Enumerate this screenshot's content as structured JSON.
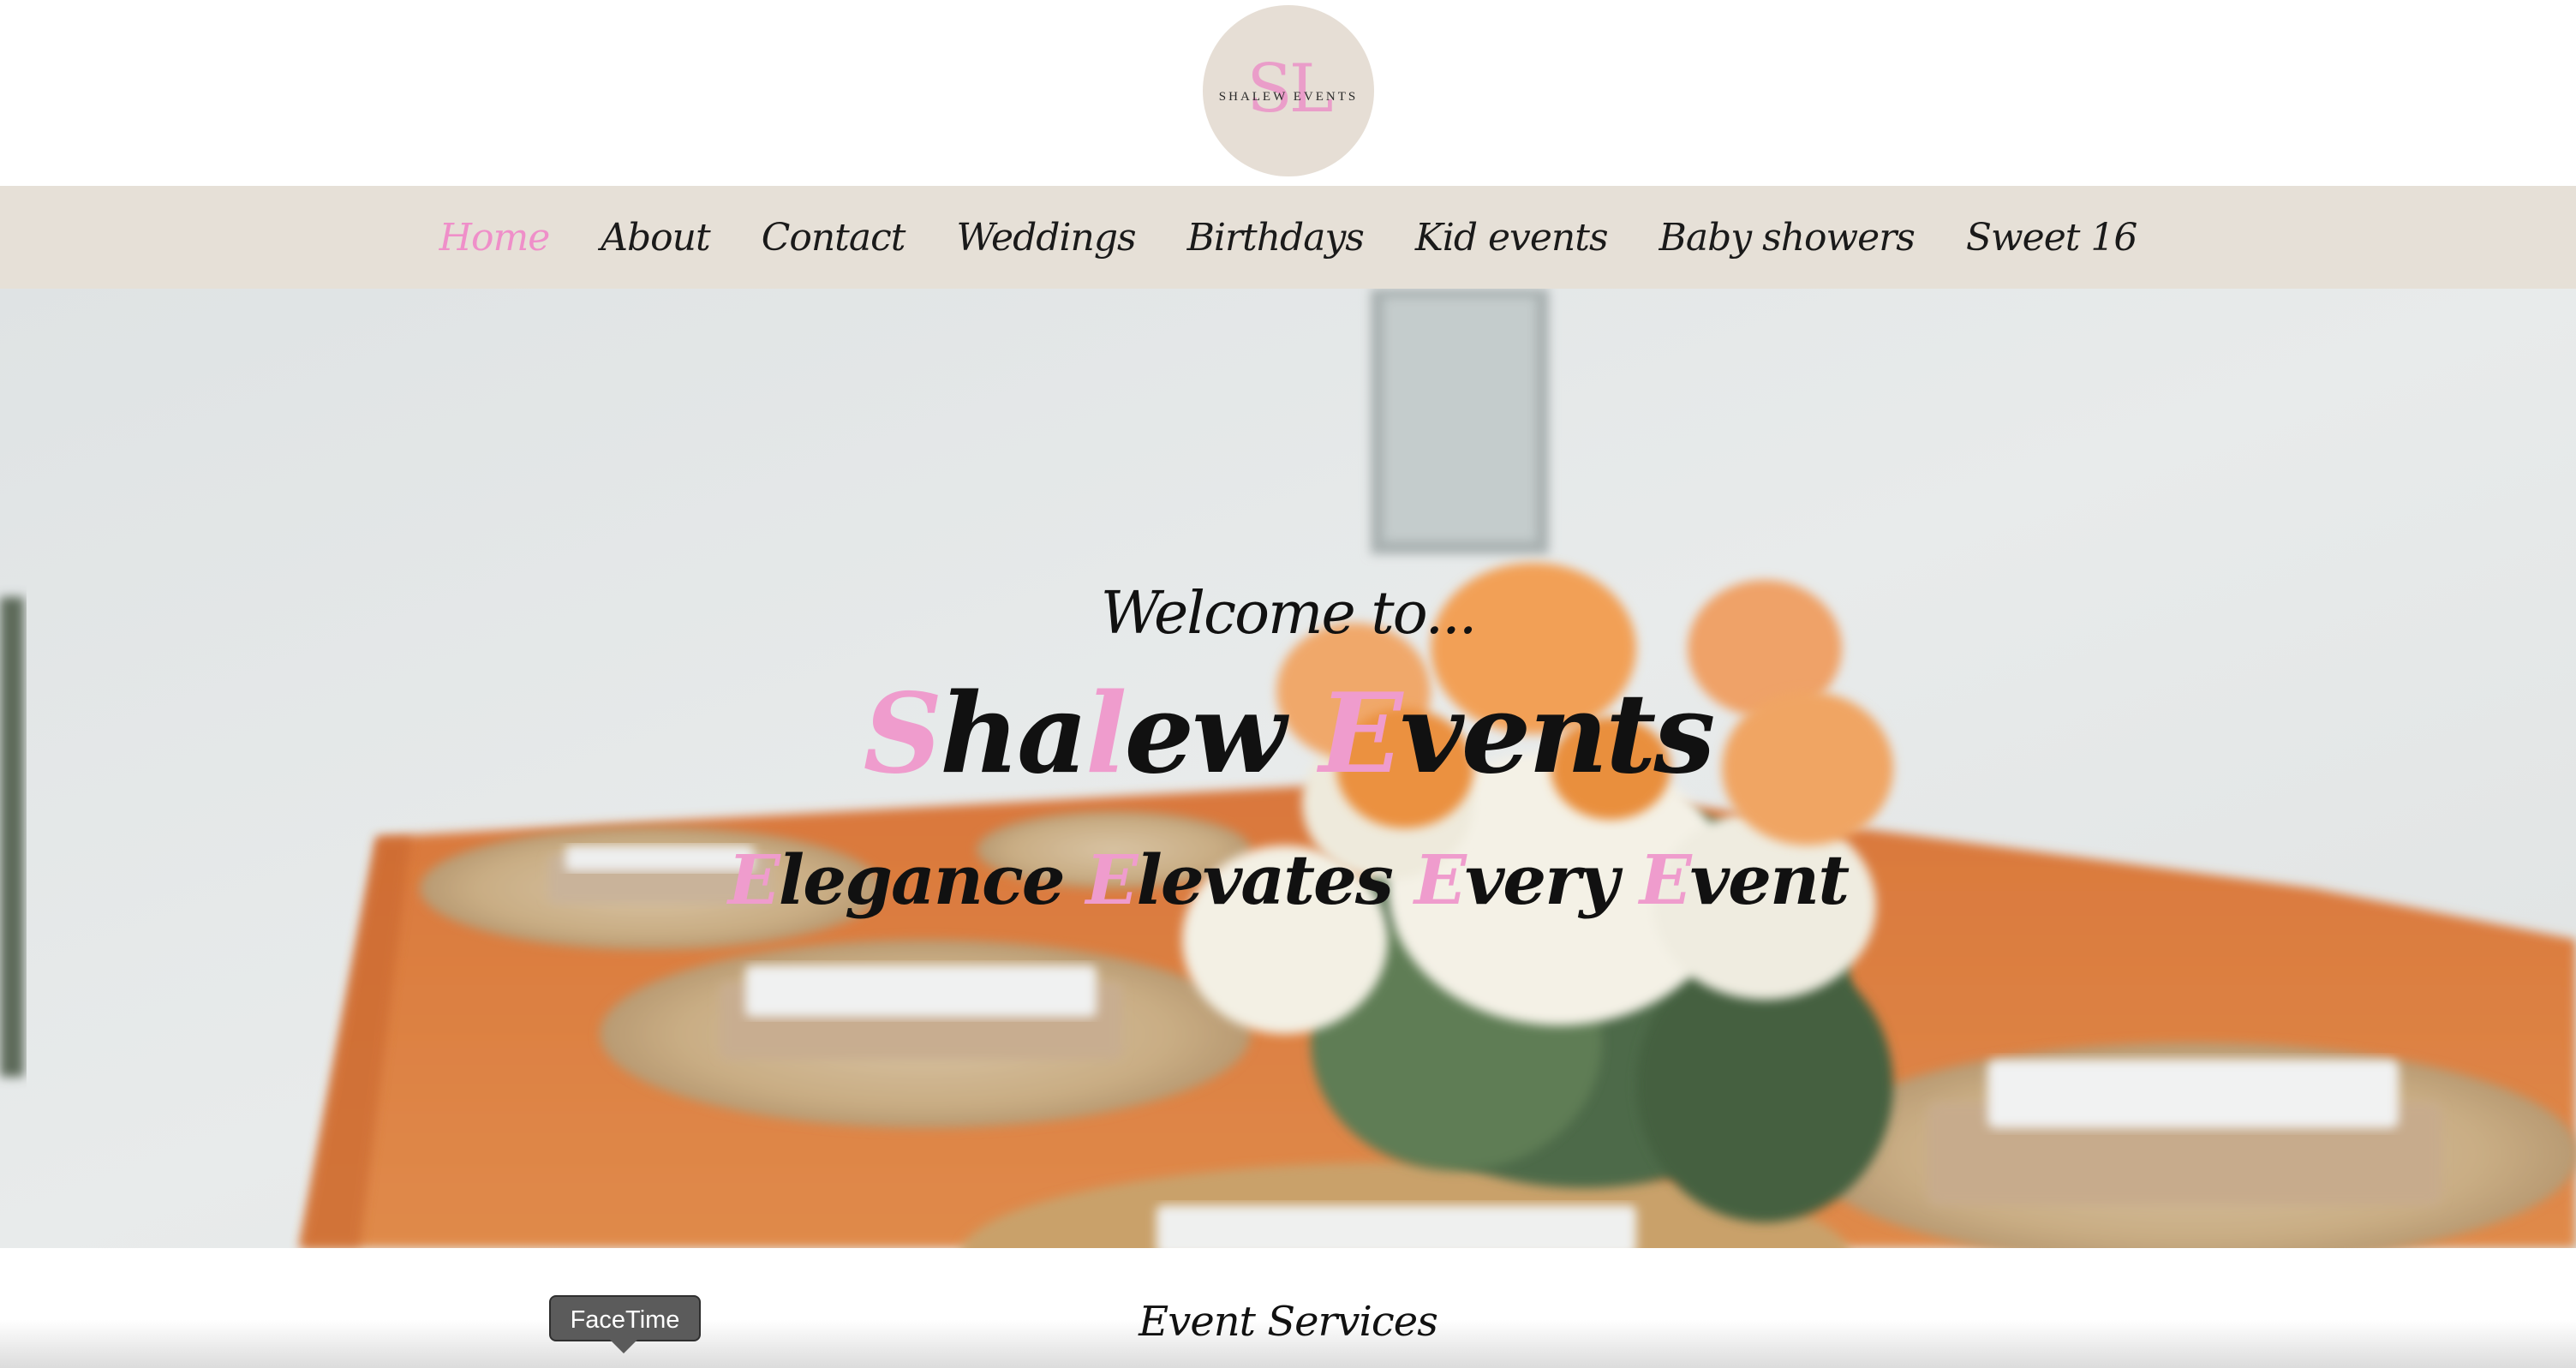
{
  "logo": {
    "monogram": "SL",
    "text": "SHALEW EVENTS"
  },
  "nav": {
    "items": [
      {
        "label": "Home",
        "active": true
      },
      {
        "label": "About",
        "active": false
      },
      {
        "label": "Contact",
        "active": false
      },
      {
        "label": "Weddings",
        "active": false
      },
      {
        "label": "Birthdays",
        "active": false
      },
      {
        "label": "Kid events",
        "active": false
      },
      {
        "label": "Baby showers",
        "active": false
      },
      {
        "label": "Sweet 16",
        "active": false
      }
    ]
  },
  "hero": {
    "welcome": "Welcome to...",
    "title": {
      "p1": "S",
      "p2": "ha",
      "p3": "l",
      "p4": "ew ",
      "p5": "E",
      "p6": "vents"
    },
    "tagline": {
      "p1": "E",
      "p2": "legance ",
      "p3": "E",
      "p4": "levates ",
      "p5": "E",
      "p6": "very ",
      "p7": "E",
      "p8": "vent"
    }
  },
  "services": {
    "title": "Event Services"
  },
  "tooltip": {
    "label": "FaceTime"
  },
  "colors": {
    "accent_pink": "#ef9ccd",
    "nav_bg": "#e6e0d7",
    "logo_bg": "#e6ded5",
    "tablecloth": "#e0803a"
  }
}
